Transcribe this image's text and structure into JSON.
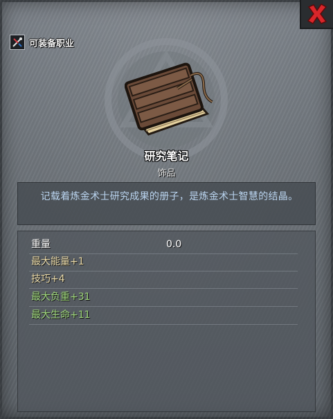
{
  "header": {
    "class_label": "可装备职业",
    "class_icon": "alchemist-class-icon",
    "close_icon": "close-x-icon"
  },
  "item": {
    "name": "研究笔记",
    "type": "饰品",
    "description": "记载着炼金术士研究成果的册子，是炼金术士智慧的结晶。",
    "image": "book-icon"
  },
  "stats": [
    {
      "label": "重量",
      "value": "0.0"
    },
    {
      "label": "最大能量+1"
    },
    {
      "label": "技巧+4"
    },
    {
      "label": "最大负重+31"
    },
    {
      "label": "最大生命+11"
    }
  ],
  "colors": {
    "desc_text": "#b9d3ee",
    "stat_gold": "#ecdcaa",
    "stat_green": "#9ed77a",
    "close_red": "#d8262a"
  }
}
